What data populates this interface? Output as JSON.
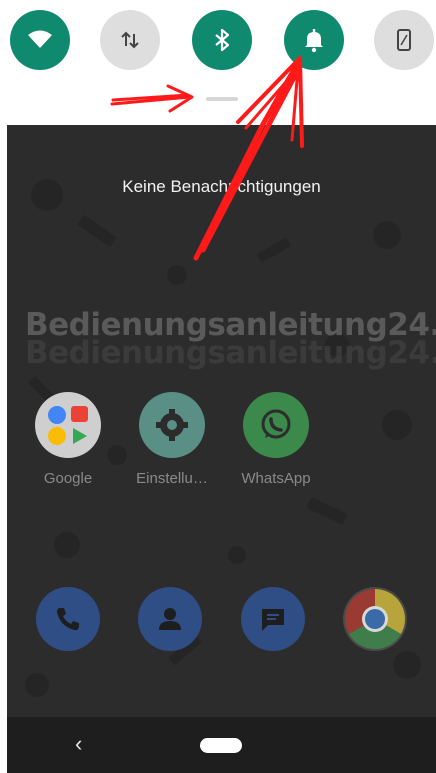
{
  "quick_settings": {
    "tiles": [
      {
        "name": "wifi",
        "icon": "wifi-icon",
        "state": "on"
      },
      {
        "name": "mobile-data",
        "icon": "data-arrows-icon",
        "state": "off"
      },
      {
        "name": "bluetooth",
        "icon": "bluetooth-icon",
        "state": "on"
      },
      {
        "name": "do-not-disturb",
        "icon": "bell-icon",
        "state": "on"
      },
      {
        "name": "auto-rotate",
        "icon": "rotate-phone-icon",
        "state": "off"
      }
    ],
    "accent_color": "#0f8a6e"
  },
  "notification_shade": {
    "empty_text": "Keine Benachrichtigungen"
  },
  "watermark": {
    "text": "Bedienungsanleitung24.de"
  },
  "home_screen": {
    "apps": [
      {
        "label": "Google",
        "icon": "google-folder-icon"
      },
      {
        "label": "Einstellu…",
        "icon": "settings-gear-icon"
      },
      {
        "label": "WhatsApp",
        "icon": "whatsapp-icon"
      }
    ],
    "dock": [
      {
        "icon": "phone-icon"
      },
      {
        "icon": "contacts-icon"
      },
      {
        "icon": "messages-icon"
      },
      {
        "icon": "chrome-icon"
      }
    ]
  },
  "navigation_bar": {
    "back_icon": "back-chevron-icon",
    "home_icon": "home-pill-icon"
  },
  "annotation_color": "#ff1a1a"
}
